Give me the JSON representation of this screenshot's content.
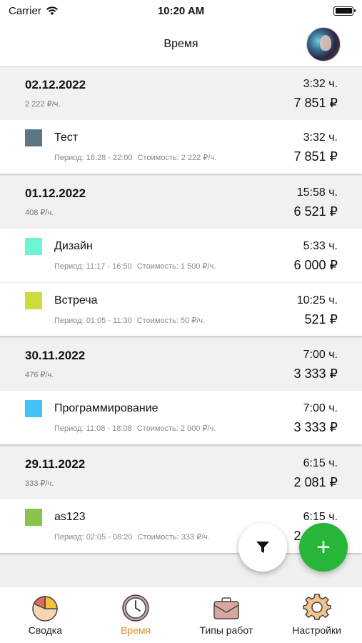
{
  "status": {
    "carrier": "Carrier",
    "time": "10:20 AM"
  },
  "nav": {
    "title": "Время"
  },
  "days": [
    {
      "date": "02.12.2022",
      "rate": "2 222 ₽/ч.",
      "hours": "3:32 ч.",
      "total": "7 851 ₽",
      "entries": [
        {
          "name": "Тест",
          "color": "#5b7689",
          "period": "Период: 18:28 - 22:00",
          "cost": "Стоимость: 2 222 ₽/ч.",
          "hours": "3:32 ч.",
          "total": "7 851 ₽"
        }
      ]
    },
    {
      "date": "01.12.2022",
      "rate": "408 ₽/ч.",
      "hours": "15:58 ч.",
      "total": "6 521 ₽",
      "entries": [
        {
          "name": "Дизайн",
          "color": "#6ff3d6",
          "period": "Период: 11:17 - 16:50",
          "cost": "Стоимость: 1 500 ₽/ч.",
          "hours": "5:33 ч.",
          "total": "6 000 ₽"
        },
        {
          "name": "Встреча",
          "color": "#cddc3a",
          "period": "Период: 01:05 - 11:30",
          "cost": "Стоимость: 50 ₽/ч.",
          "hours": "10:25 ч.",
          "total": "521 ₽"
        }
      ]
    },
    {
      "date": "30.11.2022",
      "rate": "476 ₽/ч.",
      "hours": "7:00 ч.",
      "total": "3 333 ₽",
      "entries": [
        {
          "name": "Программирование",
          "color": "#42c3f7",
          "period": "Период: 11:08 - 18:08",
          "cost": "Стоимость: 2 000 ₽/ч.",
          "hours": "7:00 ч.",
          "total": "3 333 ₽"
        }
      ]
    },
    {
      "date": "29.11.2022",
      "rate": "333 ₽/ч.",
      "hours": "6:15 ч.",
      "total": "2 081 ₽",
      "entries": [
        {
          "name": "as123",
          "color": "#8bc34a",
          "period": "Период: 02:05 - 08:20",
          "cost": "Стоимость: 333 ₽/ч.",
          "hours": "6:15 ч.",
          "total": "2 081 ₽"
        }
      ]
    }
  ],
  "fab": {
    "add_label": "+"
  },
  "tabs": [
    {
      "label": "Сводка",
      "icon": "pie-chart-icon",
      "active": false
    },
    {
      "label": "Время",
      "icon": "clock-icon",
      "active": true
    },
    {
      "label": "Типы работ",
      "icon": "briefcase-icon",
      "active": false
    },
    {
      "label": "Настройки",
      "icon": "gear-icon",
      "active": false
    }
  ]
}
